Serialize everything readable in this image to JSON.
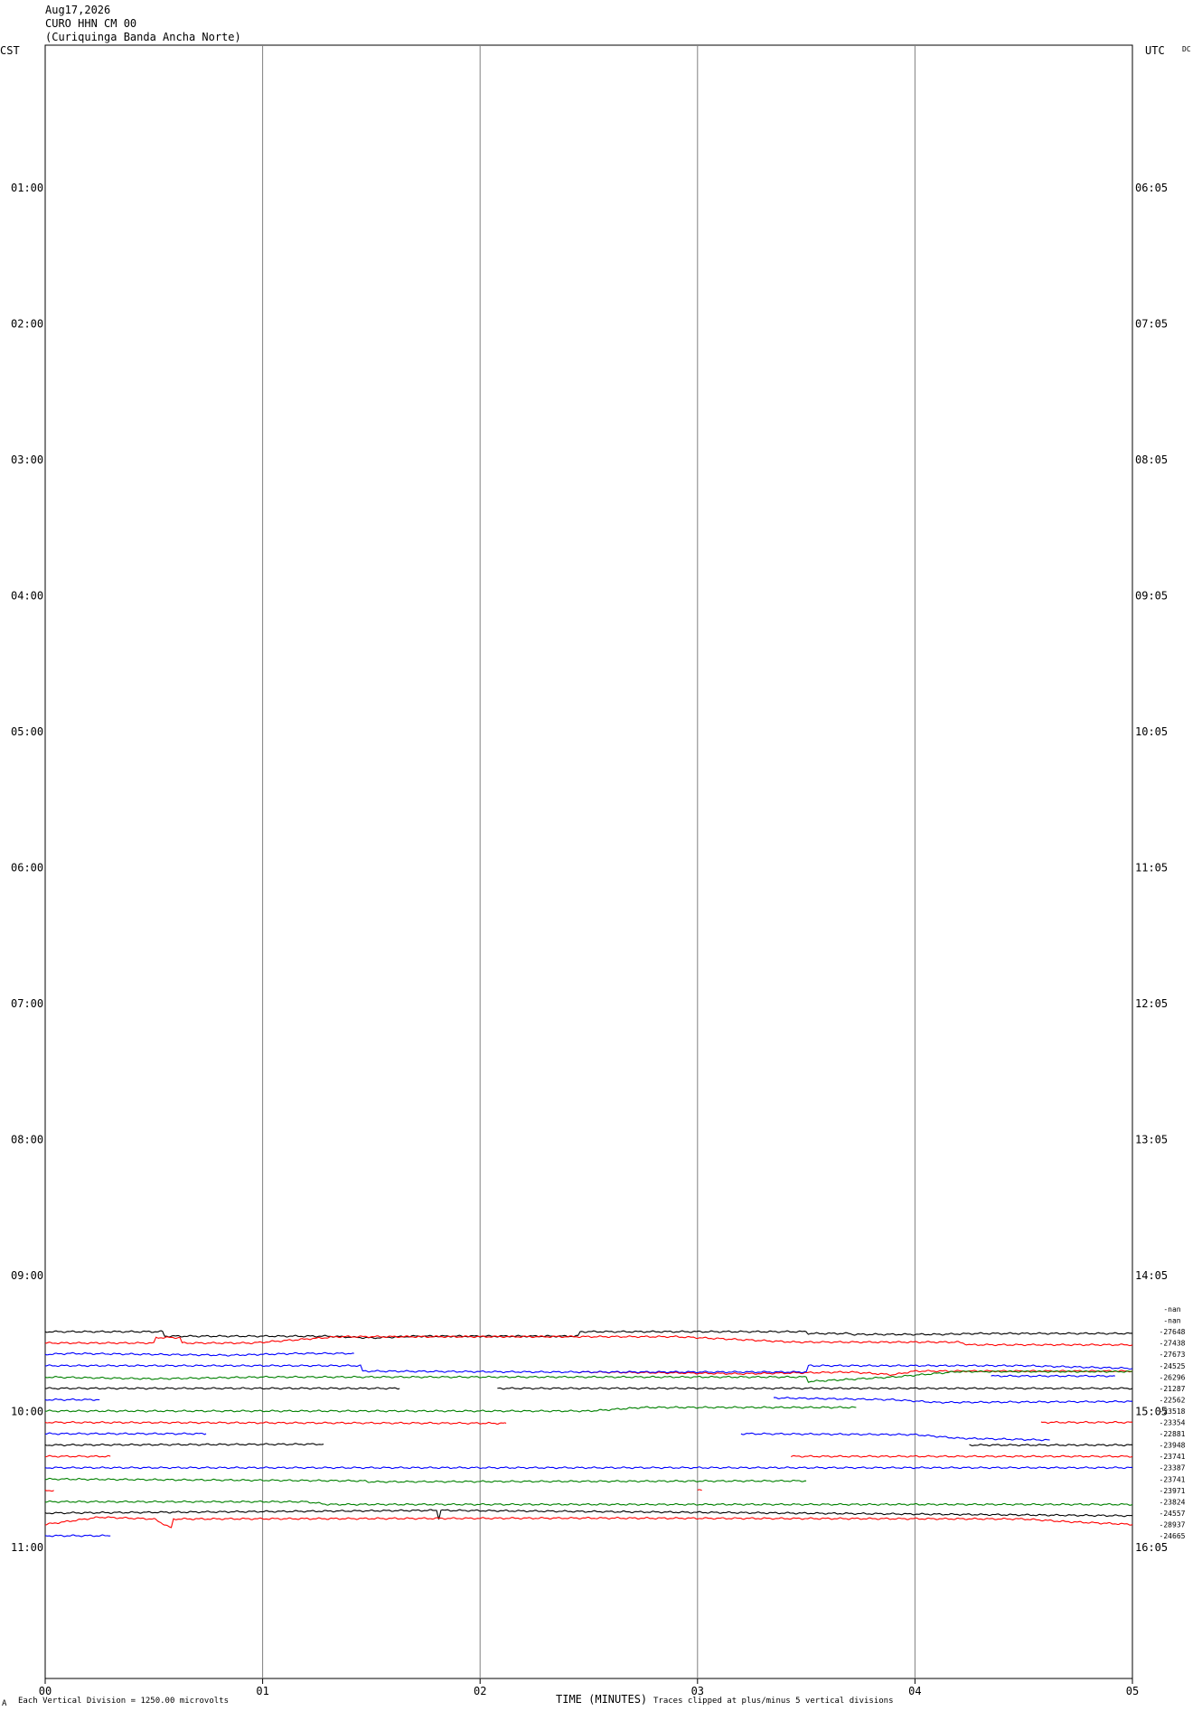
{
  "header": {
    "date": "Aug17,2026",
    "station": "CURO HHN CM 00",
    "site": "(Curiquinga Banda Ancha Norte)",
    "left_tz": "CST",
    "right_tz": "UTC",
    "mode": "DC"
  },
  "footer": {
    "scale_note": "Each Vertical Division = 1250.00 microvolts",
    "xlabel": "TIME (MINUTES)",
    "clip_note": "Traces clipped at plus/minus 5 vertical divisions",
    "corner_mark": "A"
  },
  "chart_data": {
    "type": "line",
    "title": "CURO HHN CM 00 (Curiquinga Banda Ancha Norte)",
    "xlabel": "TIME (MINUTES)",
    "ylabel": "",
    "x_ticks": [
      "00",
      "01",
      "02",
      "03",
      "04",
      "05"
    ],
    "xlim": [
      0,
      5
    ],
    "left_hour_labels": [
      "01:00",
      "02:00",
      "03:00",
      "04:00",
      "05:00",
      "06:00",
      "07:00",
      "08:00",
      "09:00",
      "10:00",
      "11:00"
    ],
    "right_hour_labels": [
      "06:05",
      "07:05",
      "08:05",
      "09:05",
      "10:05",
      "11:05",
      "12:05",
      "13:05",
      "14:05",
      "15:05",
      "16:05"
    ],
    "row_labels": [
      "-nan",
      "-nan",
      "-27648",
      "-27438",
      "-27673",
      "-24525",
      "-26296",
      "-21287",
      "-22562",
      "-23518",
      "-23354",
      "-22881",
      "-23948",
      "-23741",
      "-23387",
      "-23741",
      "-23971",
      "-23824",
      "-24557",
      "-28937",
      "-24665"
    ],
    "colors": [
      "#000000",
      "#ff0000",
      "#0000ff",
      "#008000"
    ],
    "grid": true,
    "series": [
      {
        "row": 2,
        "color": "#000000",
        "segments": [
          [
            0,
            5
          ]
        ],
        "values": [
          [
            0,
            0
          ],
          [
            0.54,
            0
          ],
          [
            0.55,
            -5
          ],
          [
            1.3,
            -5
          ],
          [
            1.5,
            -7
          ],
          [
            1.7,
            -5
          ],
          [
            2.45,
            -5
          ],
          [
            2.46,
            0
          ],
          [
            3.5,
            0
          ],
          [
            3.51,
            -2
          ],
          [
            3.7,
            -2
          ],
          [
            3.71,
            -3
          ],
          [
            4.1,
            -3
          ],
          [
            4.3,
            -2
          ],
          [
            5,
            -2
          ]
        ]
      },
      {
        "row": 3,
        "color": "#ff0000",
        "segments": [
          [
            0,
            5
          ]
        ],
        "values": [
          [
            0,
            0
          ],
          [
            0.5,
            0
          ],
          [
            0.51,
            6
          ],
          [
            0.62,
            6
          ],
          [
            0.63,
            0
          ],
          [
            0.95,
            0
          ],
          [
            1.35,
            7
          ],
          [
            2.9,
            7
          ],
          [
            3.45,
            1
          ],
          [
            4.2,
            1
          ],
          [
            4.25,
            -2
          ],
          [
            5,
            -2
          ]
        ]
      },
      {
        "row": 4,
        "color": "#0000ff",
        "segments": [
          [
            0,
            1.42
          ]
        ],
        "values": [
          [
            0,
            0
          ],
          [
            0.12,
            1
          ],
          [
            0.85,
            -1
          ],
          [
            1.16,
            1
          ],
          [
            1.42,
            1
          ]
        ]
      },
      {
        "row": 4,
        "color": "#0000ff",
        "segments": [
          [
            4.35,
            4.92
          ]
        ],
        "values": [
          [
            4.35,
            -24
          ],
          [
            4.92,
            -24
          ]
        ]
      },
      {
        "row": 5,
        "color": "#ff0000",
        "segments": [
          [
            2.45,
            5
          ]
        ],
        "values": [
          [
            2.45,
            -7
          ],
          [
            2.9,
            -8
          ],
          [
            3.2,
            -9
          ],
          [
            3.7,
            -7
          ],
          [
            3.9,
            -10
          ],
          [
            4.0,
            -6
          ],
          [
            5,
            -6
          ]
        ]
      },
      {
        "row": 5,
        "color": "#0000ff",
        "segments": [
          [
            0,
            5
          ]
        ],
        "values": [
          [
            0,
            0
          ],
          [
            1.45,
            0
          ],
          [
            1.46,
            -6
          ],
          [
            2.3,
            -7
          ],
          [
            3.5,
            -7
          ],
          [
            3.51,
            0
          ],
          [
            4.5,
            0
          ],
          [
            5,
            -3
          ]
        ]
      },
      {
        "row": 6,
        "color": "#008000",
        "segments": [
          [
            0,
            5
          ]
        ],
        "values": [
          [
            0,
            0
          ],
          [
            0.5,
            -2
          ],
          [
            1.0,
            0
          ],
          [
            3.5,
            0
          ],
          [
            3.51,
            -5
          ],
          [
            3.9,
            0
          ],
          [
            4.2,
            6
          ],
          [
            5,
            6
          ]
        ]
      },
      {
        "row": 7,
        "color": "#000000",
        "segments": [
          [
            0,
            1.63
          ]
        ],
        "values": [
          [
            0,
            0
          ],
          [
            1.63,
            0
          ]
        ]
      },
      {
        "row": 7,
        "color": "#000000",
        "segments": [
          [
            2.08,
            5
          ]
        ],
        "values": [
          [
            2.08,
            0
          ],
          [
            5,
            0
          ]
        ]
      },
      {
        "row": 8,
        "color": "#0000ff",
        "segments": [
          [
            0,
            0.25
          ]
        ],
        "values": [
          [
            0,
            0
          ],
          [
            0.25,
            0
          ]
        ]
      },
      {
        "row": 8,
        "color": "#0000ff",
        "segments": [
          [
            3.35,
            5
          ]
        ],
        "values": [
          [
            3.35,
            2
          ],
          [
            3.9,
            0
          ],
          [
            4.1,
            -3
          ],
          [
            5,
            -2
          ]
        ]
      },
      {
        "row": 9,
        "color": "#008000",
        "segments": [
          [
            0,
            3.73
          ]
        ],
        "values": [
          [
            0,
            0
          ],
          [
            2.5,
            0
          ],
          [
            2.75,
            4
          ],
          [
            3.73,
            4
          ]
        ]
      },
      {
        "row": 10,
        "color": "#ff0000",
        "segments": [
          [
            0,
            2.12
          ]
        ],
        "values": [
          [
            0,
            0
          ],
          [
            2.12,
            -1
          ]
        ]
      },
      {
        "row": 10,
        "color": "#ff0000",
        "segments": [
          [
            4.58,
            5
          ]
        ],
        "values": [
          [
            4.58,
            0
          ],
          [
            5,
            0
          ]
        ]
      },
      {
        "row": 11,
        "color": "#0000ff",
        "segments": [
          [
            0,
            0.74
          ]
        ],
        "values": [
          [
            0,
            0
          ],
          [
            0.74,
            0
          ]
        ]
      },
      {
        "row": 11,
        "color": "#0000ff",
        "segments": [
          [
            3.2,
            4.62
          ]
        ],
        "values": [
          [
            3.2,
            0
          ],
          [
            4.0,
            -1
          ],
          [
            4.2,
            -5
          ],
          [
            4.62,
            -7
          ]
        ]
      },
      {
        "row": 12,
        "color": "#000000",
        "segments": [
          [
            0,
            1.28
          ]
        ],
        "values": [
          [
            0,
            0
          ],
          [
            1.28,
            1
          ]
        ]
      },
      {
        "row": 12,
        "color": "#000000",
        "segments": [
          [
            4.25,
            5
          ]
        ],
        "values": [
          [
            4.25,
            0
          ],
          [
            5,
            0
          ]
        ]
      },
      {
        "row": 13,
        "color": "#ff0000",
        "segments": [
          [
            0,
            0.3
          ]
        ],
        "values": [
          [
            0,
            0
          ],
          [
            0.3,
            0
          ]
        ]
      },
      {
        "row": 13,
        "color": "#ff0000",
        "segments": [
          [
            3.43,
            5
          ]
        ],
        "values": [
          [
            3.43,
            0
          ],
          [
            5,
            0
          ]
        ]
      },
      {
        "row": 14,
        "color": "#0000ff",
        "segments": [
          [
            0,
            5
          ]
        ],
        "values": [
          [
            0,
            0
          ],
          [
            5,
            0
          ]
        ]
      },
      {
        "row": 15,
        "color": "#008000",
        "segments": [
          [
            0,
            3.5
          ]
        ],
        "values": [
          [
            0,
            0
          ],
          [
            1.47,
            -2
          ],
          [
            1.48,
            -3
          ],
          [
            3.5,
            -2
          ]
        ]
      },
      {
        "row": 16,
        "color": "#ff0000",
        "segments": [
          [
            0,
            0.04
          ]
        ],
        "values": [
          [
            0,
            0
          ],
          [
            0.04,
            0
          ]
        ]
      },
      {
        "row": 16,
        "color": "#ff0000",
        "segments": [
          [
            3.0,
            3.02
          ]
        ],
        "values": [
          [
            3.0,
            0
          ],
          [
            3.02,
            0
          ]
        ]
      },
      {
        "row": 17,
        "color": "#008000",
        "segments": [
          [
            0,
            5
          ]
        ],
        "values": [
          [
            0,
            0
          ],
          [
            1.2,
            0
          ],
          [
            1.3,
            -3
          ],
          [
            5,
            -3
          ]
        ]
      },
      {
        "row": 18,
        "color": "#000000",
        "segments": [
          [
            0,
            5
          ]
        ],
        "values": [
          [
            0,
            0
          ],
          [
            1.8,
            3
          ],
          [
            1.81,
            -6
          ],
          [
            1.82,
            3
          ],
          [
            5,
            -3
          ]
        ]
      },
      {
        "row": 19,
        "color": "#ff0000",
        "segments": [
          [
            0,
            5
          ]
        ],
        "values": [
          [
            0,
            0
          ],
          [
            0.25,
            8
          ],
          [
            0.5,
            6
          ],
          [
            0.58,
            -4
          ],
          [
            0.59,
            6
          ],
          [
            2.5,
            7
          ],
          [
            4.5,
            6
          ],
          [
            4.7,
            3
          ],
          [
            5,
            0
          ]
        ]
      },
      {
        "row": 20,
        "color": "#0000ff",
        "segments": [
          [
            0,
            0.3
          ]
        ],
        "values": [
          [
            0,
            0
          ],
          [
            0.3,
            0
          ]
        ]
      }
    ]
  }
}
